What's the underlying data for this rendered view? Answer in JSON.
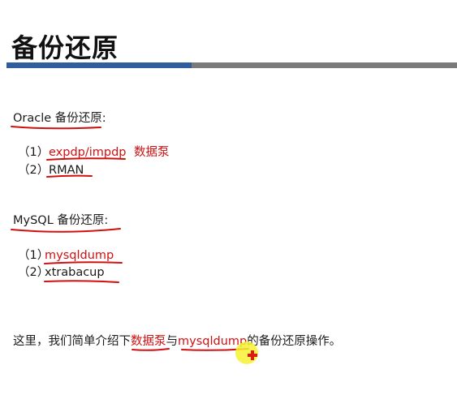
{
  "slide": {
    "title": "备份还原"
  },
  "oracle": {
    "heading": "Oracle 备份还原:",
    "item1_num": "（1）",
    "item1_tool": "expdp/impdp",
    "item1_desc": "数据泵",
    "item2_num": "（2）",
    "item2_tool": "RMAN"
  },
  "mysql": {
    "heading": "MySQL 备份还原:",
    "item1_num": "（1）",
    "item1_tool": "mysqldump",
    "item2_num": "（2）",
    "item2_tool": "xtrabacup"
  },
  "summary": {
    "prefix": "这里，我们简单介绍下",
    "highlight1": "数据泵",
    "middle": "与",
    "highlight2": "mysqldump",
    "suffix": "的备份还原操作。"
  },
  "colors": {
    "accent_red": "#d01010",
    "title_bar_blue": "#2f5d9e",
    "title_bar_gray": "#7a7a7a",
    "cursor_highlight": "#f6f232"
  },
  "icons": {
    "cursor": "pointer-highlight-icon"
  }
}
